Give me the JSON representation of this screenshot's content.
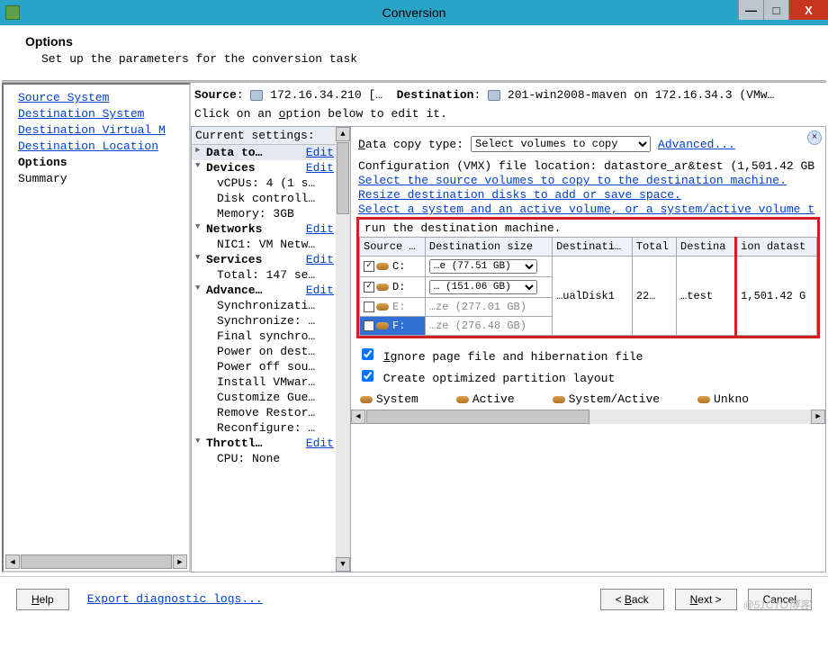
{
  "window": {
    "title": "Conversion",
    "minimize": "—",
    "maximize": "□",
    "close": "X"
  },
  "header": {
    "title": "Options",
    "subtitle": "Set up the parameters for the conversion task"
  },
  "nav": {
    "items": [
      {
        "label": "Source System",
        "link": true
      },
      {
        "label": "Destination System",
        "link": true
      },
      {
        "label": "Destination Virtual M",
        "link": true
      },
      {
        "label": "Destination Location",
        "link": true
      },
      {
        "label": "Options",
        "current": true
      },
      {
        "label": "Summary",
        "plain": true
      }
    ]
  },
  "srcdest": {
    "source_label": "Source",
    "source_value": "172.16.34.210 […",
    "dest_label": "Destination",
    "dest_value": "201-win2008-maven on 172.16.34.3 (VMw…"
  },
  "instruct": "Click on an option below to edit it.",
  "tree": {
    "header": "Current settings:",
    "edit": "Edit",
    "items": [
      {
        "label": "Data to…",
        "caret": "►",
        "bold": true,
        "selected": true,
        "edit": true
      },
      {
        "label": "Devices",
        "caret": "▼",
        "bold": true,
        "edit": true
      },
      {
        "label": "vCPUs: 4 (1 s…",
        "indent": 1
      },
      {
        "label": "Disk controll…",
        "indent": 1
      },
      {
        "label": "Memory: 3GB",
        "indent": 1
      },
      {
        "label": "Networks",
        "caret": "▼",
        "bold": true,
        "edit": true
      },
      {
        "label": "NIC1: VM Netw…",
        "indent": 1
      },
      {
        "label": "Services",
        "caret": "▼",
        "bold": true,
        "edit": true
      },
      {
        "label": "Total: 147 se…",
        "indent": 1
      },
      {
        "label": "Advance…",
        "caret": "▼",
        "bold": true,
        "edit": true
      },
      {
        "label": "Synchronizati…",
        "indent": 1
      },
      {
        "label": "Synchronize: …",
        "indent": 1
      },
      {
        "label": "Final synchro…",
        "indent": 1
      },
      {
        "label": "Power on dest…",
        "indent": 1
      },
      {
        "label": "Power off sou…",
        "indent": 1
      },
      {
        "label": "Install VMwar…",
        "indent": 1
      },
      {
        "label": "Customize Gue…",
        "indent": 1
      },
      {
        "label": "Remove Restor…",
        "indent": 1
      },
      {
        "label": "Reconfigure: …",
        "indent": 1
      },
      {
        "label": "Throttl…",
        "caret": "▼",
        "bold": true,
        "edit": true
      },
      {
        "label": "CPU: None",
        "indent": 1
      }
    ]
  },
  "detail": {
    "copy_label": "Data copy type:",
    "copy_select": "Select volumes to copy",
    "advanced": "Advanced...",
    "config_line": "Configuration (VMX) file location: datastore_ar&test (1,501.42 GB",
    "select_src": "Select the source volumes to copy to the destination machine.",
    "resize": "Resize destination disks to add or save space.",
    "select_sys": "Select a system and an active volume, or a system/active volume t",
    "run_msg": "run the destination machine.",
    "table": {
      "headers": [
        "Source …",
        "Destination size",
        "Destinati…",
        "Total",
        "Destina",
        "ion datast"
      ],
      "rows": [
        {
          "checked": true,
          "drive": "C:",
          "size": "…e (77.51 GB)",
          "active": true
        },
        {
          "checked": true,
          "drive": "D:",
          "size": "… (151.06 GB)",
          "active": true
        },
        {
          "checked": false,
          "drive": "E:",
          "size": "…ze (277.01 GB)",
          "active": false
        },
        {
          "checked": false,
          "drive": "F:",
          "size": "…ze (276.48 GB)",
          "active": false,
          "sel": true
        }
      ],
      "merged": {
        "disk": "…ualDisk1",
        "total": "22…",
        "dest": "…test",
        "datast": "1,501.42 G"
      }
    },
    "check_ignore": "Ignore page file and hibernation file",
    "check_optimize": "Create optimized partition layout",
    "legend": {
      "system": "System",
      "active": "Active",
      "sysact": "System/Active",
      "unkno": "Unkno"
    }
  },
  "footer": {
    "help": "Help",
    "diag": "Export diagnostic logs...",
    "back": "< Back",
    "next": "Next >",
    "cancel": "Cancel"
  },
  "watermark": "@51CTO博客"
}
